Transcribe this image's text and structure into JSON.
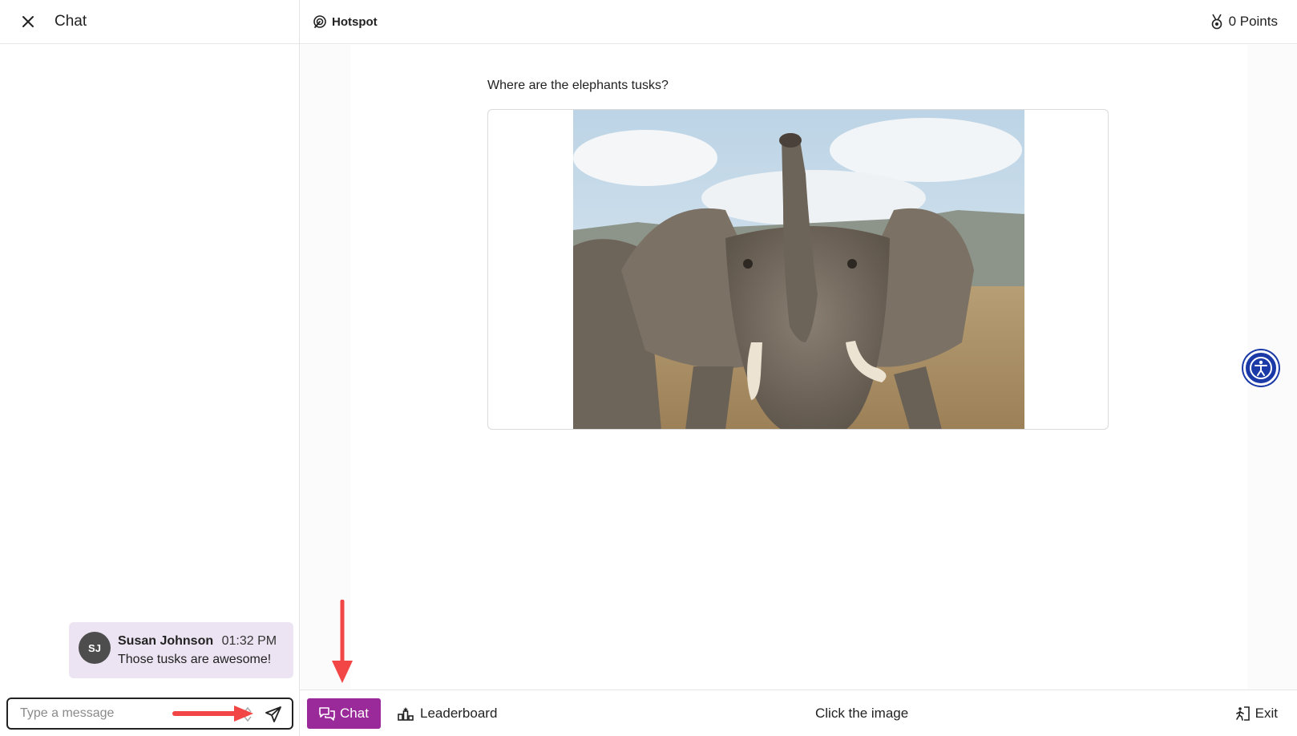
{
  "chat_panel": {
    "title": "Chat",
    "close_icon": "close-icon",
    "messages": [
      {
        "initials": "SJ",
        "author": "Susan Johnson",
        "time": "01:32 PM",
        "text": "Those tusks are awesome!"
      }
    ],
    "input": {
      "placeholder": "Type a message",
      "value": ""
    },
    "send_icon": "send-icon"
  },
  "topbar": {
    "activity_label": "Hotspot",
    "activity_icon": "hotspot-icon",
    "points_label": "0 Points",
    "points_icon": "medal-icon"
  },
  "main": {
    "question": "Where are the elephants tusks?",
    "image_subject": "elephant-photo"
  },
  "bottombar": {
    "chat_label": "Chat",
    "leaderboard_label": "Leaderboard",
    "hint": "Click the image",
    "exit_label": "Exit"
  },
  "colors": {
    "chat_button": "#9a2a9a",
    "message_bubble": "#ece4f2",
    "accessibility_button": "#1b3aa8",
    "annotation_arrow": "#f24545"
  }
}
